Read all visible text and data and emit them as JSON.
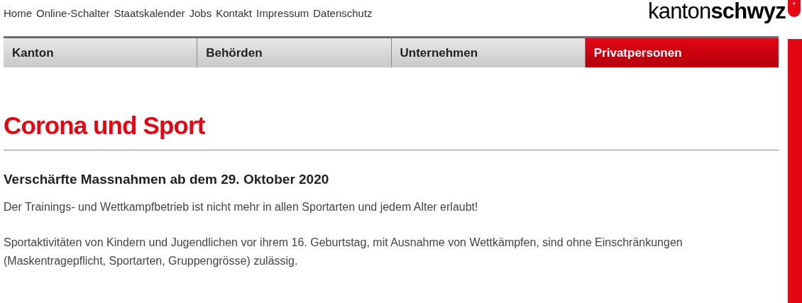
{
  "top_links": [
    "Home",
    "Online-Schalter",
    "Staatskalender",
    "Jobs",
    "Kontakt",
    "Impressum",
    "Datenschutz"
  ],
  "logo": {
    "light": "kanton",
    "bold": "schwyz",
    "mark": "+"
  },
  "nav": [
    {
      "label": "Kanton",
      "selected": false
    },
    {
      "label": "Behörden",
      "selected": false
    },
    {
      "label": "Unternehmen",
      "selected": false
    },
    {
      "label": "Privatpersonen",
      "selected": true
    }
  ],
  "title": "Corona und Sport",
  "subheading": "Verschärfte Massnahmen ab dem 29. Oktober 2020",
  "paragraphs": [
    "Der Trainings- und Wettkampfbetrieb ist nicht mehr in allen Sportarten und jedem Alter erlaubt!",
    "Sportaktivitäten von Kindern und Jugendlichen vor ihrem 16. Geburtstag, mit Ausnahme von Wettkämpfen, sind ohne Einschränkungen (Maskentragepflicht, Sportarten, Gruppengrösse) zulässig."
  ]
}
